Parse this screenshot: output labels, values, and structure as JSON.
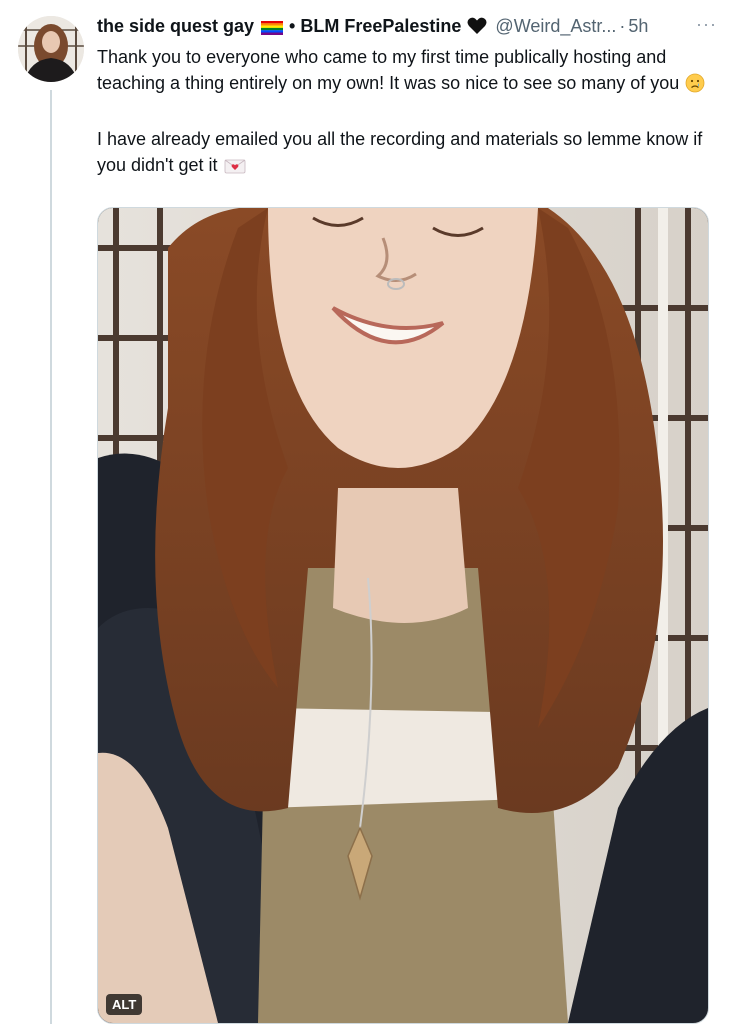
{
  "tweet": {
    "display_name": "the side quest gay",
    "name_suffix": "BLM FreePalestine",
    "separator_dot": "•",
    "handle": "@Weird_Astr...",
    "time_separator": "·",
    "timestamp": "5h",
    "more_label": "···",
    "text_para1": "Thank you to everyone who came to my first time publically hosting and teaching a thing entirely on my own! It was so nice to see so many of you",
    "text_para2": "I have already emailed you all the recording and materials so lemme know if you didn't get it",
    "media_alt_badge": "ALT",
    "icons": [
      "rainbow-flag-icon",
      "black-heart-icon",
      "crying-face-emoji",
      "love-letter-emoji"
    ]
  },
  "colors": {
    "text_primary": "#0f1419",
    "text_secondary": "#536471",
    "thread_line": "#cfd9de"
  }
}
